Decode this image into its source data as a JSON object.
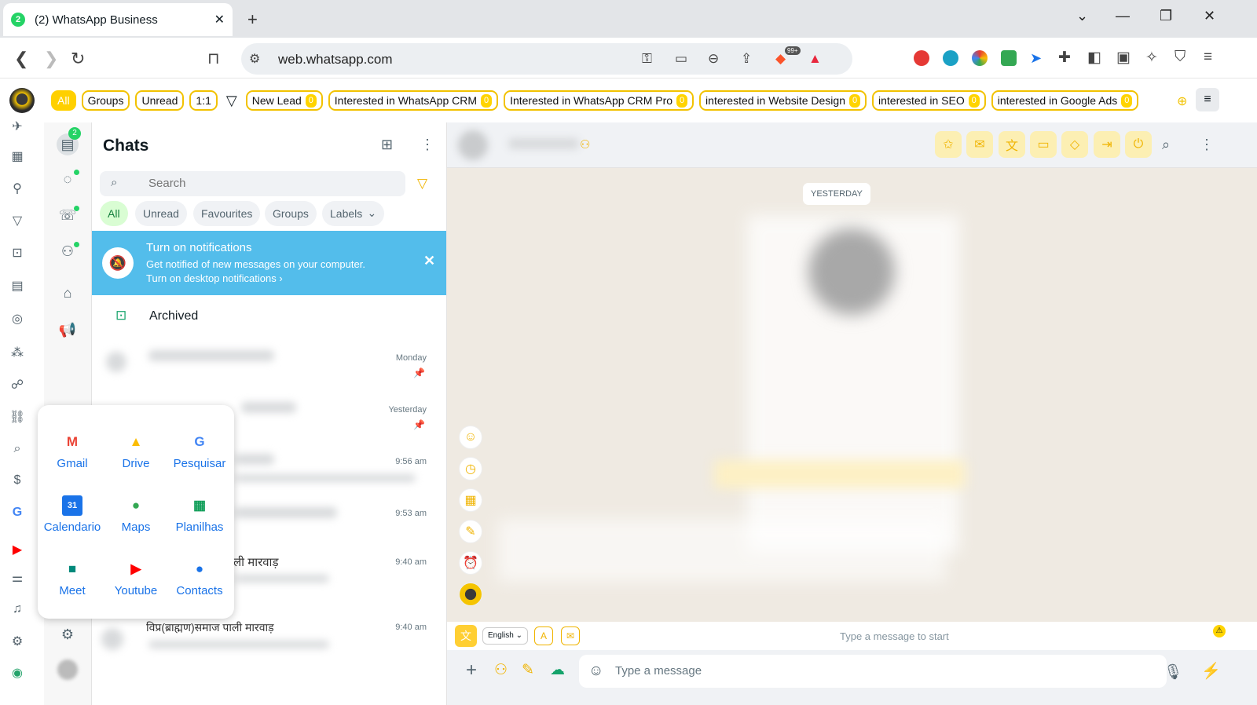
{
  "browser": {
    "tab": {
      "badge": "2",
      "title": "(2) WhatsApp Business",
      "close": "✕"
    },
    "new_tab": "+",
    "url": "web.whatsapp.com",
    "brave_badge": "99+"
  },
  "labels_bar": {
    "items": [
      {
        "label": "All",
        "active": true
      },
      {
        "label": "Groups"
      },
      {
        "label": "Unread"
      },
      {
        "label": "1:1"
      }
    ],
    "custom": [
      {
        "label": "New Lead",
        "count": "0"
      },
      {
        "label": "Interested in WhatsApp CRM",
        "count": "0"
      },
      {
        "label": "Interested in WhatsApp CRM Pro",
        "count": "0"
      },
      {
        "label": "interested in Website Design",
        "count": "0"
      },
      {
        "label": "interested in SEO",
        "count": "0"
      },
      {
        "label": "interested in Google Ads",
        "count": "0"
      }
    ]
  },
  "nav": {
    "status_badge": "2"
  },
  "chats": {
    "title": "Chats",
    "search_placeholder": "Search",
    "filters": [
      "All",
      "Unread",
      "Favourites",
      "Groups",
      "Labels"
    ],
    "notification": {
      "title": "Turn on notifications",
      "body": "Get notified of new messages on your computer.",
      "link": "Turn on desktop notifications"
    },
    "archived": "Archived",
    "rows": [
      {
        "time": "Monday",
        "name": ""
      },
      {
        "time": "Yesterday",
        "name": ""
      },
      {
        "time": "9:56 am",
        "name": ""
      },
      {
        "time": "9:53 am",
        "name": ""
      },
      {
        "time": "9:40 am",
        "name": "ली मारवाड़"
      },
      {
        "time": "9:40 am",
        "name": "विप्र(ब्राह्मण)समाज पाली मारवाड़"
      }
    ]
  },
  "conversation": {
    "date_chip": "YESTERDAY",
    "language": "English",
    "hint": "Type a message to start",
    "placeholder": "Type a message"
  },
  "google_apps": [
    {
      "name": "Gmail",
      "icon": "gmail-icon",
      "glyph": "M",
      "color": "#ea4335"
    },
    {
      "name": "Drive",
      "icon": "drive-icon",
      "glyph": "▲",
      "color": "#fbbc04"
    },
    {
      "name": "Pesquisar",
      "icon": "google-search-icon",
      "glyph": "G",
      "color": "#4285f4"
    },
    {
      "name": "Calendario",
      "icon": "calendar-icon",
      "glyph": "31",
      "color": "#1a73e8"
    },
    {
      "name": "Maps",
      "icon": "maps-icon",
      "glyph": "●",
      "color": "#34a853"
    },
    {
      "name": "Planilhas",
      "icon": "sheets-icon",
      "glyph": "▦",
      "color": "#0f9d58"
    },
    {
      "name": "Meet",
      "icon": "meet-icon",
      "glyph": "■",
      "color": "#00897b"
    },
    {
      "name": "Youtube",
      "icon": "youtube-icon",
      "glyph": "▶",
      "color": "#ff0000"
    },
    {
      "name": "Contacts",
      "icon": "contacts-icon",
      "glyph": "●",
      "color": "#1a73e8"
    }
  ]
}
